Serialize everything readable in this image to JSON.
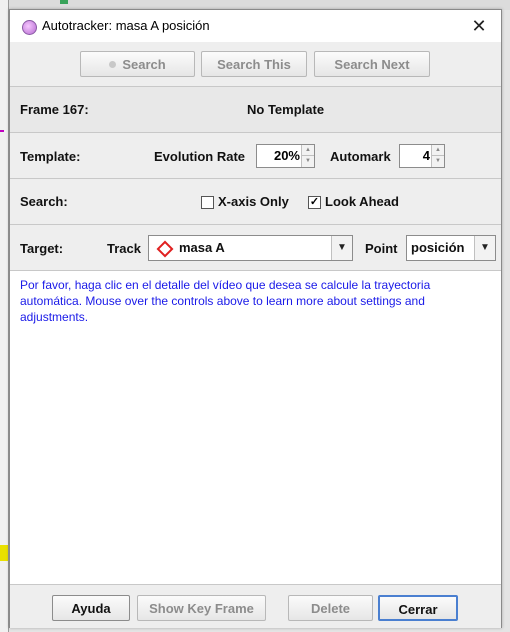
{
  "window": {
    "title": "Autotracker: masa A posición",
    "close_glyph": "✕"
  },
  "search_bar": {
    "search_label": "Search",
    "search_this_label": "Search This",
    "search_next_label": "Search Next"
  },
  "frame_row": {
    "frame_label": "Frame 167:",
    "status": "No Template"
  },
  "template_row": {
    "label": "Template:",
    "evolution_rate_label": "Evolution Rate",
    "evolution_rate_value": "20%",
    "automark_label": "Automark",
    "automark_value": "4"
  },
  "search_row": {
    "label": "Search:",
    "x_axis_only_label": "X-axis Only",
    "x_axis_only_checked": false,
    "look_ahead_label": "Look Ahead",
    "look_ahead_checked": true
  },
  "target_row": {
    "label": "Target:",
    "track_label": "Track",
    "track_value": "masa A",
    "point_label": "Point",
    "point_value": "posición"
  },
  "info": {
    "text": "Por favor, haga clic en el detalle del vídeo que desea se calcule la trayectoria automática. Mouse over the controls above to learn more about settings and adjustments."
  },
  "footer": {
    "help_label": "Ayuda",
    "show_key_frame_label": "Show Key Frame",
    "delete_label": "Delete",
    "close_label": "Cerrar"
  }
}
